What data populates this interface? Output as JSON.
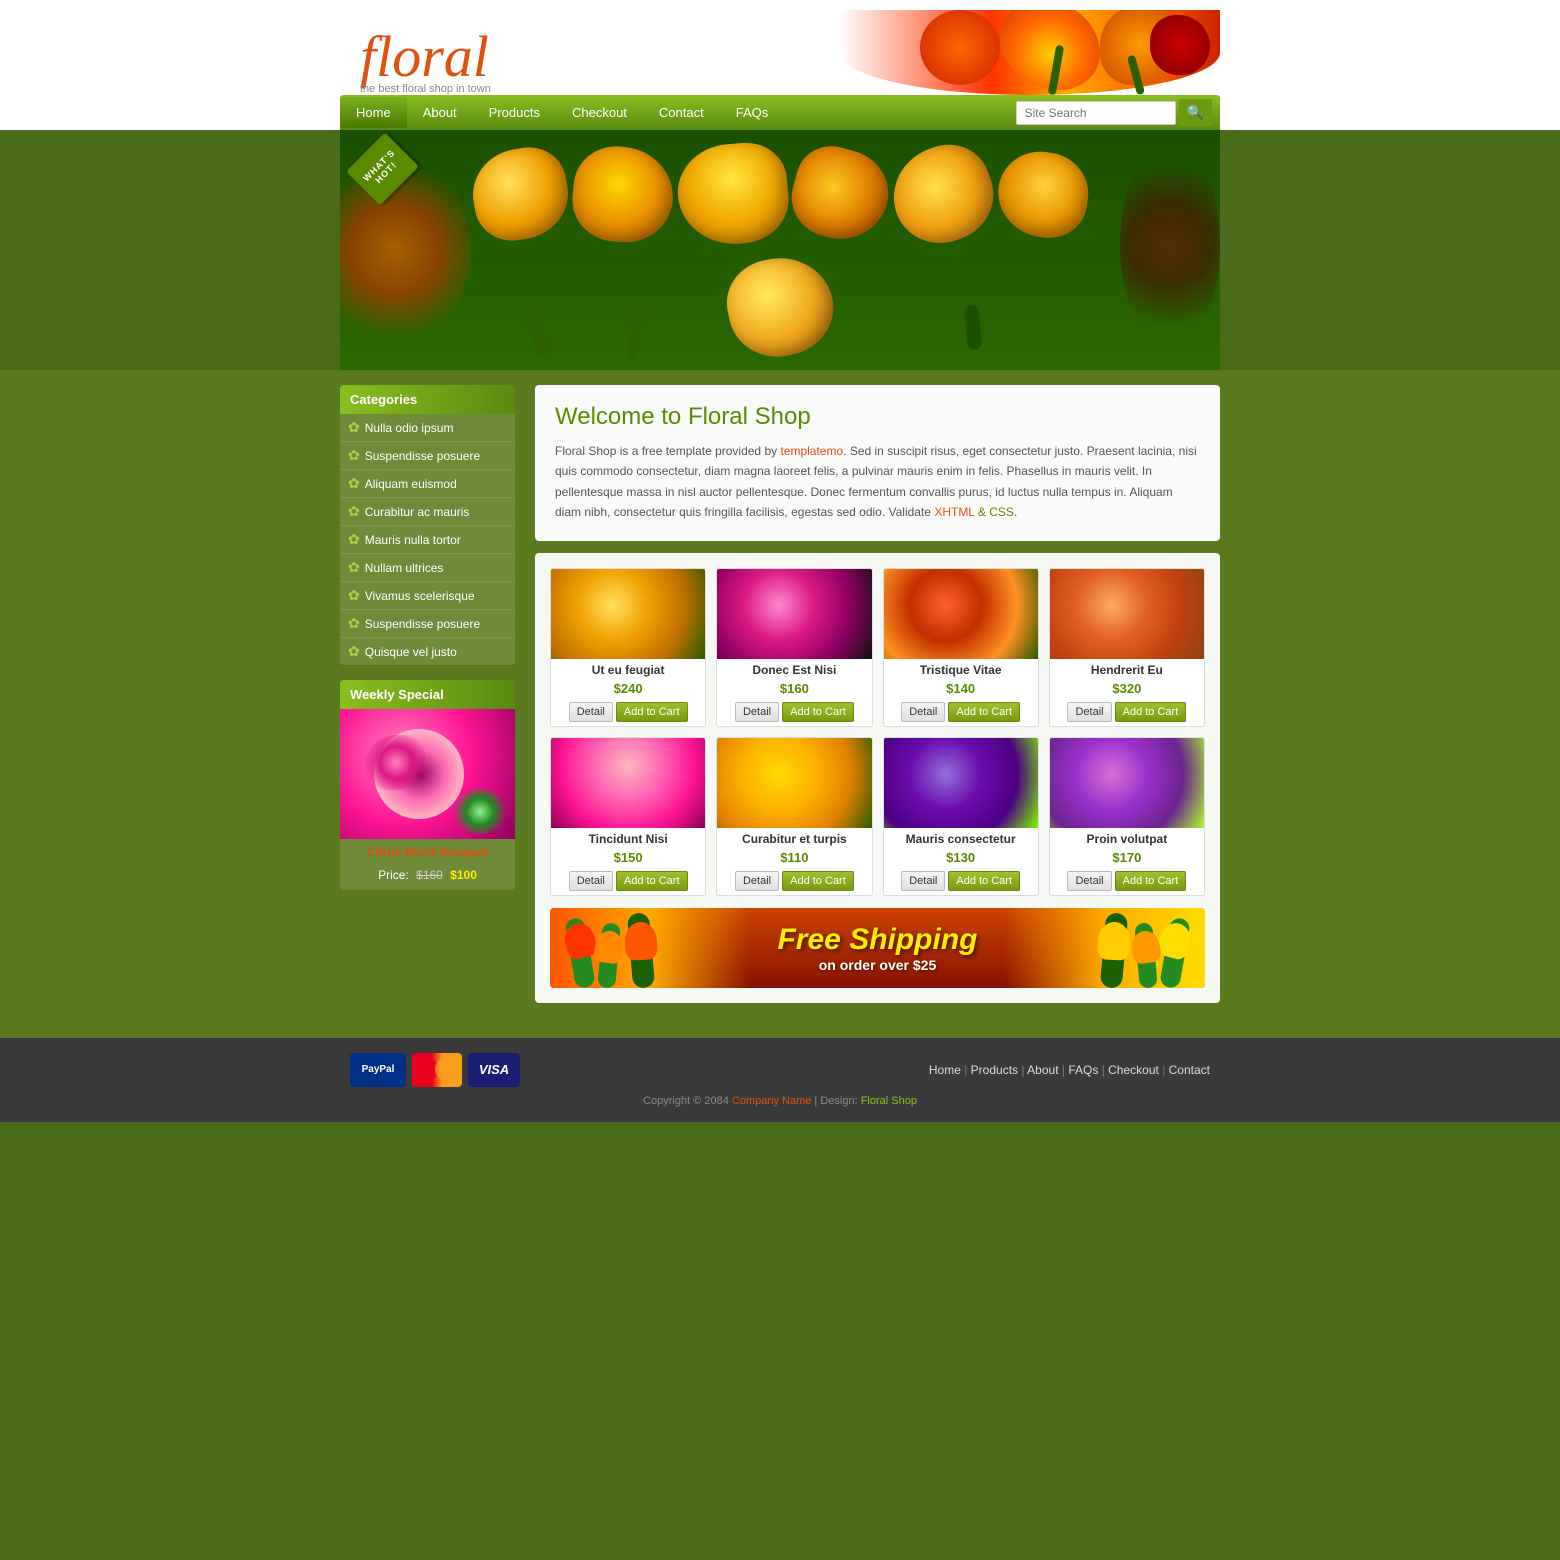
{
  "header": {
    "logo_text": "floral",
    "logo_tagline": "the best floral shop in town",
    "hero_badge": "WHAT'S HOT!"
  },
  "nav": {
    "items": [
      {
        "label": "Home",
        "active": true
      },
      {
        "label": "About"
      },
      {
        "label": "Products"
      },
      {
        "label": "Checkout"
      },
      {
        "label": "Contact"
      },
      {
        "label": "FAQs"
      }
    ],
    "search_placeholder": "Site Search"
  },
  "sidebar": {
    "categories_title": "Categories",
    "categories": [
      {
        "label": "Nulla odio ipsum"
      },
      {
        "label": "Suspendisse posuere"
      },
      {
        "label": "Aliquam euismod"
      },
      {
        "label": "Curabitur ac mauris"
      },
      {
        "label": "Mauris nulla tortor"
      },
      {
        "label": "Nullam ultrices"
      },
      {
        "label": "Vivamus scelerisque"
      },
      {
        "label": "Suspendisse posuere"
      },
      {
        "label": "Quisque vel justo"
      }
    ],
    "weekly_title": "Weekly Special",
    "weekly_name": "Citrus Burst Bouquet",
    "weekly_price_label": "Price:",
    "weekly_old_price": "$160",
    "weekly_new_price": "$100"
  },
  "welcome": {
    "title": "Welcome to Floral Shop",
    "text_part1": "Floral Shop is a free template provided by ",
    "link_label": "templatemo",
    "text_part2": ". Sed in suscipit risus, eget consectetur justo. Praesent lacinia, nisi quis commodo consectetur, diam magna laoreet felis, a pulvinar mauris enim in felis. Phasellus in mauris velit. In pellentesque massa in nisl auctor pellentesque. Donec fermentum convallis purus, id luctus nulla tempus in. Aliquam diam nibh, consectetur quis fringilla facilisis, egestas sed odio. Validate ",
    "xhtml_label": "XHTML",
    "css_label": "CSS",
    "text_end": "."
  },
  "products": {
    "row1": [
      {
        "name": "Ut eu feugiat",
        "price": "$240",
        "color": "flower-yellow"
      },
      {
        "name": "Donec Est Nisi",
        "price": "$160",
        "color": "flower-pink"
      },
      {
        "name": "Tristique Vitae",
        "price": "$140",
        "color": "flower-mixed"
      },
      {
        "name": "Hendrerit Eu",
        "price": "$320",
        "color": "flower-orange"
      }
    ],
    "row2": [
      {
        "name": "Tincidunt Nisi",
        "price": "$150",
        "color": "flower-light-pink"
      },
      {
        "name": "Curabitur et turpis",
        "price": "$110",
        "color": "flower-yellow2"
      },
      {
        "name": "Mauris consectetur",
        "price": "$130",
        "color": "flower-purple"
      },
      {
        "name": "Proin volutpat",
        "price": "$170",
        "color": "flower-purple2"
      }
    ],
    "detail_btn": "Detail",
    "cart_btn": "Add to Cart"
  },
  "shipping": {
    "main": "Free Shipping",
    "sub": "on order over $25"
  },
  "footer": {
    "nav_items": [
      {
        "label": "Home"
      },
      {
        "label": "Products"
      },
      {
        "label": "About"
      },
      {
        "label": "FAQs"
      },
      {
        "label": "Checkout"
      },
      {
        "label": "Contact"
      }
    ],
    "copyright": "Copyright © 2084 ",
    "company_name": "Company Name",
    "design_prefix": " | Design: ",
    "design_link": "Floral Shop"
  }
}
